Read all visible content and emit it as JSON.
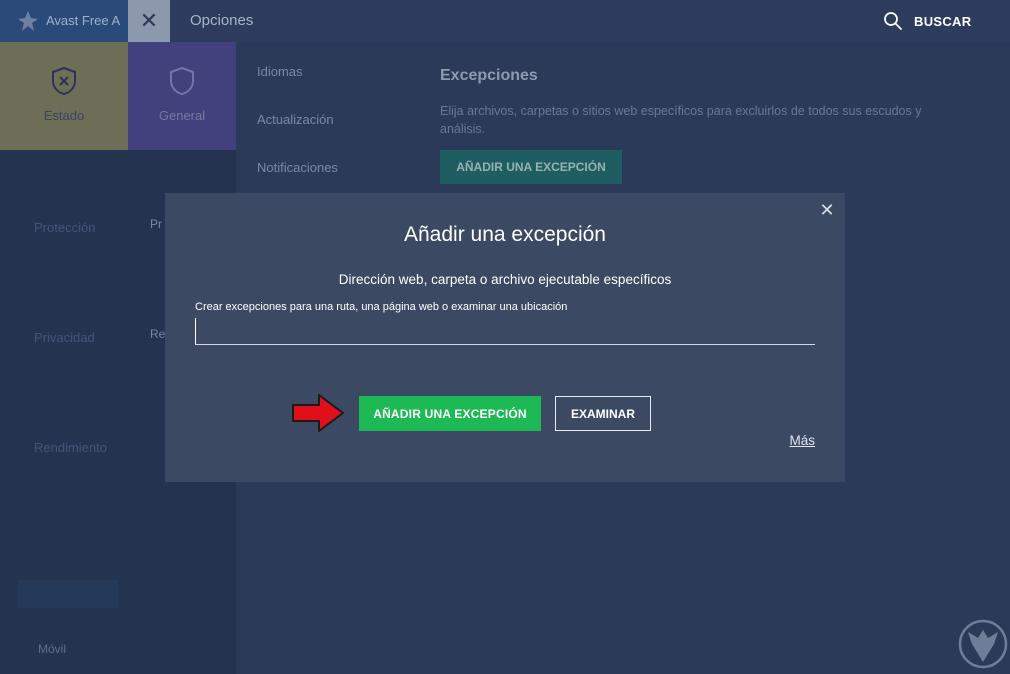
{
  "window": {
    "brand_name": "Avast Free A",
    "section_title": "Opciones",
    "search_label": "BUSCAR"
  },
  "sidebar": {
    "tiles": [
      {
        "label": "Estado"
      },
      {
        "label": "General"
      }
    ],
    "categories": [
      "Protección",
      "Privacidad",
      "Rendimiento"
    ],
    "sub_items": [
      "Pr",
      "Re"
    ],
    "bottom_label": "Móvil"
  },
  "subnav": [
    "Idiomas",
    "Actualización",
    "Notificaciones"
  ],
  "content": {
    "title": "Excepciones",
    "description": "Elija archivos, carpetas o sitios web específicos para excluirlos de todos sus escudos y análisis.",
    "button_label": "AÑADIR UNA EXCEPCIÓN"
  },
  "dialog": {
    "title": "Añadir una excepción",
    "subtitle": "Dirección web, carpeta o archivo ejecutable específicos",
    "field_label": "Crear excepciones para una ruta, una página web o examinar una ubicación",
    "field_value": "",
    "add_button": "AÑADIR UNA EXCEPCIÓN",
    "browse_button": "EXAMINAR",
    "more_link": "Más",
    "close_symbol": "✕"
  },
  "colors": {
    "accent_green": "#1db954",
    "annotation_red": "#e0101a",
    "dialog_bg": "#3c4962"
  }
}
